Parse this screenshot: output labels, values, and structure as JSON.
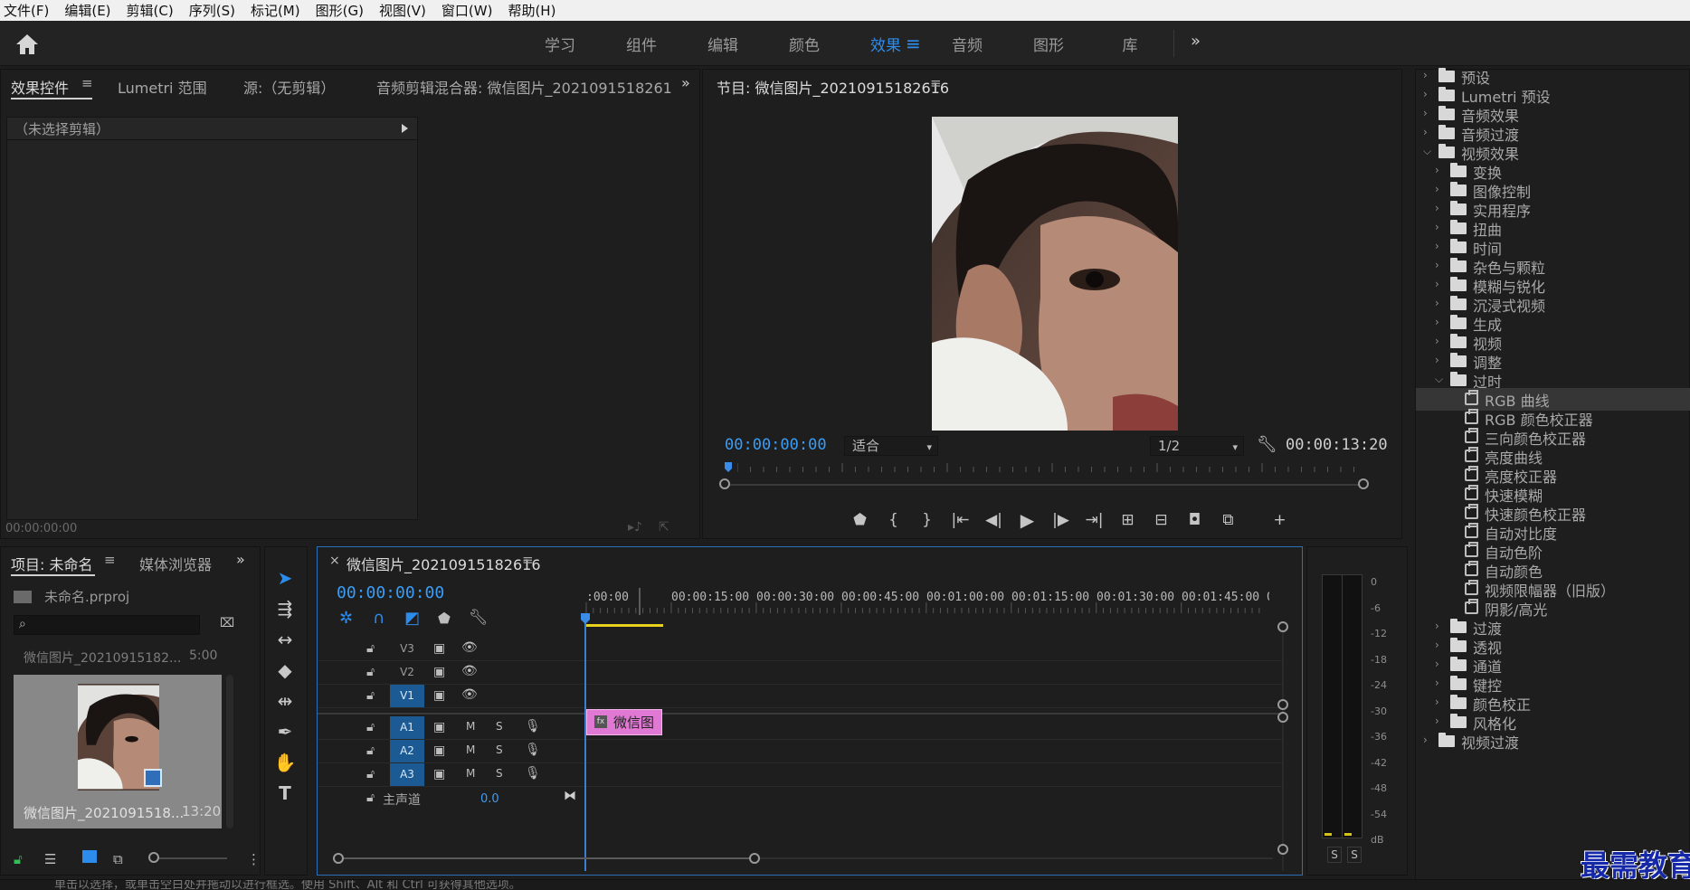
{
  "menu": [
    "文件(F)",
    "编辑(E)",
    "剪辑(C)",
    "序列(S)",
    "标记(M)",
    "图形(G)",
    "视图(V)",
    "窗口(W)",
    "帮助(H)"
  ],
  "workspaces": [
    "学习",
    "组件",
    "编辑",
    "颜色",
    "效果",
    "音频",
    "图形",
    "库"
  ],
  "active_workspace": "效果",
  "source_panel": {
    "tabs": [
      "效果控件",
      "Lumetri 范围",
      "源:（无剪辑）",
      "音频剪辑混合器: 微信图片_2021091518261"
    ],
    "no_clip": "（未选择剪辑）",
    "timecode": "00:00:00:00"
  },
  "program": {
    "title": "节目: 微信图片_20210915182616",
    "timecode_left": "00:00:00:00",
    "fit": "适合",
    "resolution": "1/2",
    "timecode_right": "00:00:13:20"
  },
  "effects": {
    "rows": [
      {
        "label": "预设",
        "level": 0,
        "type": "folder",
        "open": false
      },
      {
        "label": "Lumetri 预设",
        "level": 0,
        "type": "folder",
        "open": false
      },
      {
        "label": "音频效果",
        "level": 0,
        "type": "folder",
        "open": false
      },
      {
        "label": "音频过渡",
        "level": 0,
        "type": "folder",
        "open": false
      },
      {
        "label": "视频效果",
        "level": 0,
        "type": "folder",
        "open": true
      },
      {
        "label": "变换",
        "level": 1,
        "type": "folder",
        "open": false
      },
      {
        "label": "图像控制",
        "level": 1,
        "type": "folder",
        "open": false
      },
      {
        "label": "实用程序",
        "level": 1,
        "type": "folder",
        "open": false
      },
      {
        "label": "扭曲",
        "level": 1,
        "type": "folder",
        "open": false
      },
      {
        "label": "时间",
        "level": 1,
        "type": "folder",
        "open": false
      },
      {
        "label": "杂色与颗粒",
        "level": 1,
        "type": "folder",
        "open": false
      },
      {
        "label": "模糊与锐化",
        "level": 1,
        "type": "folder",
        "open": false
      },
      {
        "label": "沉浸式视频",
        "level": 1,
        "type": "folder",
        "open": false
      },
      {
        "label": "生成",
        "level": 1,
        "type": "folder",
        "open": false
      },
      {
        "label": "视频",
        "level": 1,
        "type": "folder",
        "open": false
      },
      {
        "label": "调整",
        "level": 1,
        "type": "folder",
        "open": false
      },
      {
        "label": "过时",
        "level": 1,
        "type": "folder",
        "open": true
      },
      {
        "label": "RGB 曲线",
        "level": 2,
        "type": "effect",
        "selected": true
      },
      {
        "label": "RGB 颜色校正器",
        "level": 2,
        "type": "effect"
      },
      {
        "label": "三向颜色校正器",
        "level": 2,
        "type": "effect"
      },
      {
        "label": "亮度曲线",
        "level": 2,
        "type": "effect"
      },
      {
        "label": "亮度校正器",
        "level": 2,
        "type": "effect"
      },
      {
        "label": "快速模糊",
        "level": 2,
        "type": "effect"
      },
      {
        "label": "快速颜色校正器",
        "level": 2,
        "type": "effect"
      },
      {
        "label": "自动对比度",
        "level": 2,
        "type": "effect"
      },
      {
        "label": "自动色阶",
        "level": 2,
        "type": "effect"
      },
      {
        "label": "自动颜色",
        "level": 2,
        "type": "effect"
      },
      {
        "label": "视频限幅器（旧版）",
        "level": 2,
        "type": "effect"
      },
      {
        "label": "阴影/高光",
        "level": 2,
        "type": "effect"
      },
      {
        "label": "过渡",
        "level": 1,
        "type": "folder",
        "open": false
      },
      {
        "label": "透视",
        "level": 1,
        "type": "folder",
        "open": false
      },
      {
        "label": "通道",
        "level": 1,
        "type": "folder",
        "open": false
      },
      {
        "label": "键控",
        "level": 1,
        "type": "folder",
        "open": false
      },
      {
        "label": "颜色校正",
        "level": 1,
        "type": "folder",
        "open": false
      },
      {
        "label": "风格化",
        "level": 1,
        "type": "folder",
        "open": false
      },
      {
        "label": "视频过渡",
        "level": 0,
        "type": "folder",
        "open": false
      }
    ]
  },
  "watermark": "最需教育",
  "project": {
    "tabs": [
      "项目: 未命名",
      "媒体浏览器"
    ],
    "file": "未命名.prproj",
    "clip_header": "微信图片_20210915182...",
    "clip_header_dur": "5:00",
    "clip_name": "微信图片_2021091518...",
    "clip_dur": "13:20"
  },
  "timeline": {
    "tab": "微信图片_20210915182616",
    "timecode": "00:00:00:00",
    "ruler": [
      ":00:00",
      "00:00:15:00",
      "00:00:30:00",
      "00:00:45:00",
      "00:01:00:00",
      "00:01:15:00",
      "00:01:30:00",
      "00:01:45:00",
      "00:02:0"
    ],
    "video_tracks": [
      "V3",
      "V2",
      "V1"
    ],
    "audio_tracks": [
      "A1",
      "A2",
      "A3"
    ],
    "audio_m": "M",
    "audio_s": "S",
    "master": "主声道",
    "master_value": "0.0",
    "clip": "微信图"
  },
  "meter": {
    "scale": [
      "0",
      "-6",
      "-12",
      "-18",
      "-24",
      "-30",
      "-36",
      "-42",
      "-48",
      "-54",
      "dB"
    ],
    "solo": [
      "S",
      "S"
    ]
  },
  "status": "单击以选择，或单击空白处并拖动以进行框选。使用 Shift、Alt 和 Ctrl 可获得其他选项。"
}
